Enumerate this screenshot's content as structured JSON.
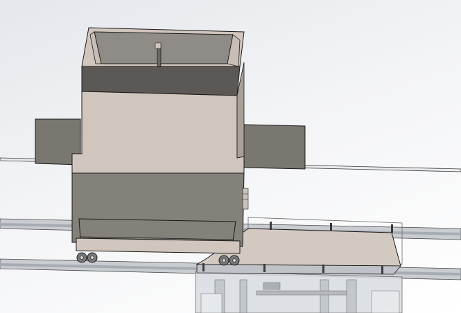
{
  "viewport": {
    "background_top": "#e4e7ec",
    "background_bottom": "#ffffff"
  },
  "model": {
    "colors": {
      "hopper_body": "#d0c6bd",
      "hopper_dark_band": "#5c5856",
      "hopper_lower": "#84807a",
      "side_wing": "#7a7670",
      "hopper_cavity": "#8f8b86",
      "table_top": "#d2c9c0",
      "rail": "#b8bcc2",
      "frame_glass": "#cfd3d8",
      "wheel": "#6a6a6a",
      "edge": "#1a1a1a"
    }
  }
}
